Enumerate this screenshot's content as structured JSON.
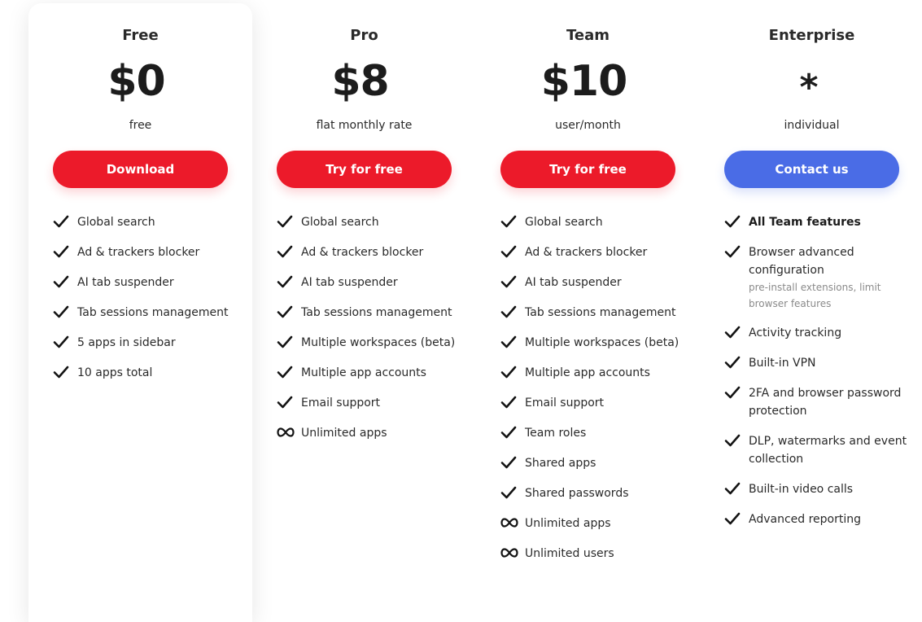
{
  "plans": [
    {
      "name": "Free",
      "price": "$0",
      "unit": "free",
      "button": "Download",
      "features": [
        {
          "icon": "check-icon",
          "label": "Global search"
        },
        {
          "icon": "check-icon",
          "label": "Ad & trackers blocker"
        },
        {
          "icon": "check-icon",
          "label": "AI tab suspender"
        },
        {
          "icon": "check-icon",
          "label": "Tab sessions management"
        },
        {
          "icon": "check-icon",
          "label": "5 apps in sidebar"
        },
        {
          "icon": "check-icon",
          "label": "10 apps total"
        }
      ]
    },
    {
      "name": "Pro",
      "price": "$8",
      "unit": "flat monthly rate",
      "button": "Try for free",
      "features": [
        {
          "icon": "check-icon",
          "label": "Global search"
        },
        {
          "icon": "check-icon",
          "label": "Ad & trackers blocker"
        },
        {
          "icon": "check-icon",
          "label": "AI tab suspender"
        },
        {
          "icon": "check-icon",
          "label": "Tab sessions management"
        },
        {
          "icon": "check-icon",
          "label": "Multiple workspaces (beta)"
        },
        {
          "icon": "check-icon",
          "label": "Multiple app accounts"
        },
        {
          "icon": "check-icon",
          "label": "Email support"
        },
        {
          "icon": "infinity-icon",
          "label": "Unlimited apps"
        }
      ]
    },
    {
      "name": "Team",
      "price": "$10",
      "unit": "user/month",
      "button": "Try for free",
      "features": [
        {
          "icon": "check-icon",
          "label": "Global search"
        },
        {
          "icon": "check-icon",
          "label": "Ad & trackers blocker"
        },
        {
          "icon": "check-icon",
          "label": "AI tab suspender"
        },
        {
          "icon": "check-icon",
          "label": "Tab sessions management"
        },
        {
          "icon": "check-icon",
          "label": "Multiple workspaces (beta)"
        },
        {
          "icon": "check-icon",
          "label": "Multiple app accounts"
        },
        {
          "icon": "check-icon",
          "label": "Email support"
        },
        {
          "icon": "check-icon",
          "label": "Team roles"
        },
        {
          "icon": "check-icon",
          "label": "Shared apps"
        },
        {
          "icon": "check-icon",
          "label": "Shared passwords"
        },
        {
          "icon": "infinity-icon",
          "label": "Unlimited apps"
        },
        {
          "icon": "infinity-icon",
          "label": "Unlimited users"
        }
      ]
    },
    {
      "name": "Enterprise",
      "price": "*",
      "unit": "individual",
      "button": "Contact us",
      "features": [
        {
          "icon": "check-icon",
          "label": "All Team features",
          "bold": true
        },
        {
          "icon": "check-icon",
          "label": "Browser advanced configuration",
          "note": "pre-install extensions, limit browser features"
        },
        {
          "icon": "check-icon",
          "label": "Activity tracking"
        },
        {
          "icon": "check-icon",
          "label": "Built-in VPN"
        },
        {
          "icon": "check-icon",
          "label": "2FA and browser password protection"
        },
        {
          "icon": "check-icon",
          "label": "DLP, watermarks and event collection"
        },
        {
          "icon": "check-icon",
          "label": "Built-in video calls"
        },
        {
          "icon": "check-icon",
          "label": "Advanced reporting"
        }
      ]
    }
  ],
  "colors": {
    "primary_button": "#ec1a2a",
    "contact_button": "#4a6ce6",
    "text": "#1c1c1c",
    "note": "#8a8a8a"
  }
}
